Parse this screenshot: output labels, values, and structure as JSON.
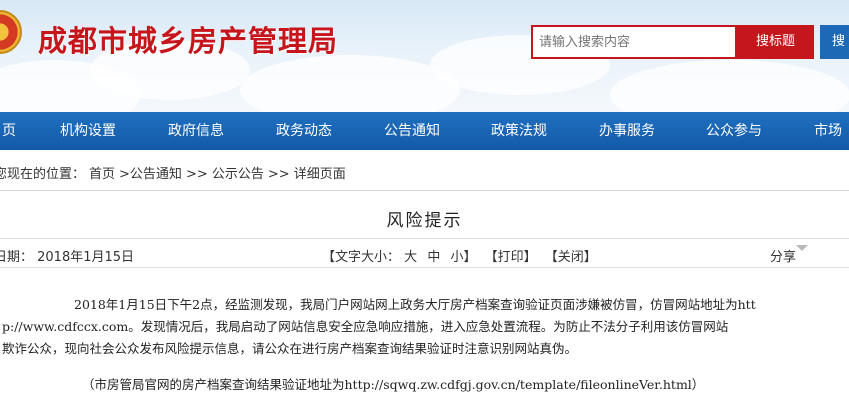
{
  "header": {
    "site_title": "成都市城乡房产管理局",
    "search_placeholder": "请输入搜索内容",
    "search_button_label": "搜标题",
    "search_button2_label": "搜",
    "emblem_icon": "emblem-icon"
  },
  "nav": {
    "items": [
      {
        "label": "页"
      },
      {
        "label": "机构设置"
      },
      {
        "label": "政府信息"
      },
      {
        "label": "政务动态"
      },
      {
        "label": "公告通知"
      },
      {
        "label": "政策法规"
      },
      {
        "label": "办事服务"
      },
      {
        "label": "公众参与"
      },
      {
        "label": "市场"
      }
    ]
  },
  "breadcrumb": {
    "prefix": "您现在的位置：",
    "items": [
      "首页",
      ">公告通知",
      ">> 公示公告",
      ">> 详细页面"
    ]
  },
  "article": {
    "title": "风险提示",
    "date_label": "日期：  2018年1月15日",
    "font_size_label": "【文字大小：",
    "size_large": "大",
    "size_medium": "中",
    "size_small": "小】",
    "print_label": "【打印】",
    "close_label": "【关闭】",
    "share_label": "分享",
    "paragraph_line1": "2018年1月15日下午2点，经监测发现，我局门户网站网上政务大厅房产档案查询验证页面涉嫌被仿冒，仿冒网站地址为htt",
    "paragraph_line2": "p://www.cdfccx.com。发现情况后，我局启动了网站信息安全应急响应措施，进入应急处置流程。为防止不法分子利用该仿冒网站",
    "paragraph_line3": "欺诈公众，现向社会公众发布风险提示信息，请公众在进行房产档案查询结果验证时注意识别网站真伪。",
    "note": "（市房管局官网的房产档案查询结果验证地址为http://sqwq.zw.cdfgj.gov.cn/template/fileonlineVer.html）"
  },
  "colors": {
    "brand_red": "#c4161c",
    "nav_blue": "#1a65b3",
    "search_blue": "#1e69b5"
  }
}
